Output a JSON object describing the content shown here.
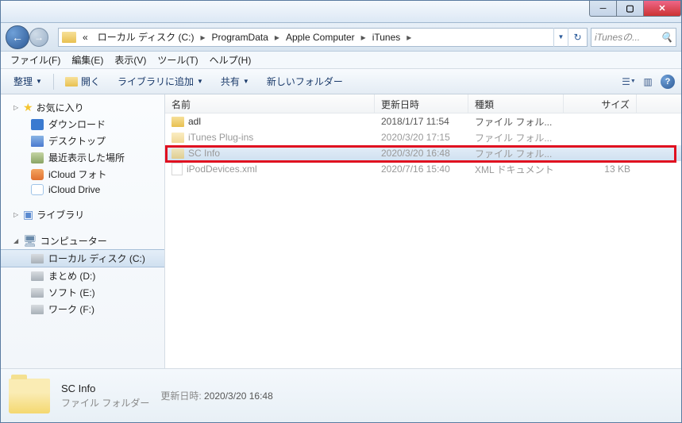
{
  "search": {
    "placeholder": "iTunesの..."
  },
  "breadcrumb": {
    "prefix": "«",
    "items": [
      "ローカル ディスク (C:)",
      "ProgramData",
      "Apple Computer",
      "iTunes"
    ]
  },
  "menu": {
    "file": "ファイル(F)",
    "edit": "編集(E)",
    "view": "表示(V)",
    "tools": "ツール(T)",
    "help": "ヘルプ(H)"
  },
  "toolbar": {
    "organize": "整理",
    "open": "開く",
    "add_library": "ライブラリに追加",
    "share": "共有",
    "new_folder": "新しいフォルダー"
  },
  "sidebar": {
    "favorites": {
      "label": "お気に入り",
      "items": [
        "ダウンロード",
        "デスクトップ",
        "最近表示した場所",
        "iCloud フォト",
        "iCloud Drive"
      ]
    },
    "libraries": {
      "label": "ライブラリ"
    },
    "computer": {
      "label": "コンピューター",
      "items": [
        "ローカル ディスク (C:)",
        "まとめ (D:)",
        "ソフト (E:)",
        "ワーク (F:)"
      ]
    }
  },
  "columns": {
    "name": "名前",
    "date": "更新日時",
    "type": "種類",
    "size": "サイズ"
  },
  "files": [
    {
      "name": "adl",
      "date": "2018/1/17 11:54",
      "type": "ファイル フォル...",
      "size": "",
      "icon": "folder",
      "dim": false,
      "selected": false
    },
    {
      "name": "iTunes Plug-ins",
      "date": "2020/3/20 17:15",
      "type": "ファイル フォル...",
      "size": "",
      "icon": "folder",
      "dim": true,
      "selected": false
    },
    {
      "name": "SC Info",
      "date": "2020/3/20 16:48",
      "type": "ファイル フォル...",
      "size": "",
      "icon": "folder",
      "dim": true,
      "selected": true
    },
    {
      "name": "iPodDevices.xml",
      "date": "2020/7/16 15:40",
      "type": "XML ドキュメント",
      "size": "13 KB",
      "icon": "xml",
      "dim": true,
      "selected": false
    }
  ],
  "details": {
    "name": "SC Info",
    "type": "ファイル フォルダー",
    "date_label": "更新日時:",
    "date": "2020/3/20 16:48"
  }
}
